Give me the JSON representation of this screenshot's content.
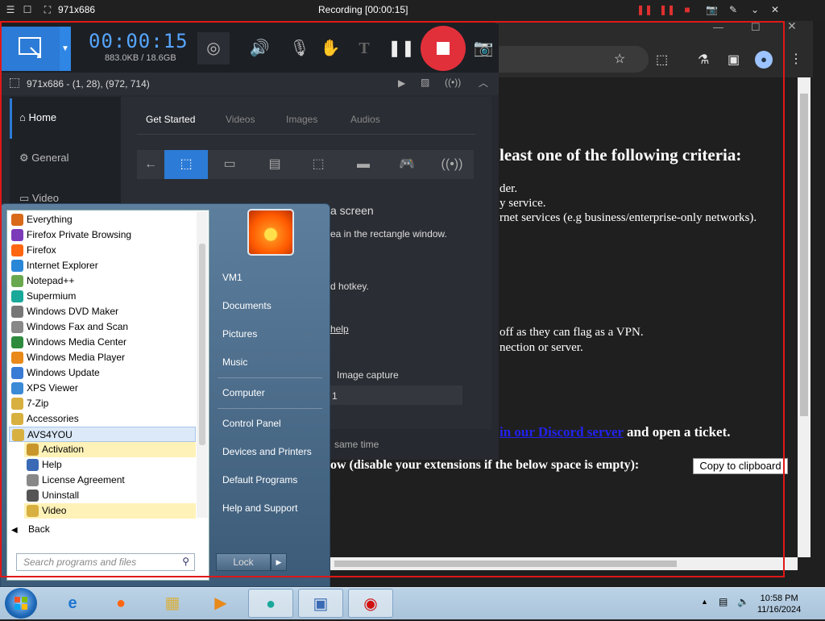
{
  "recorder_bar": {
    "resolution": "971x686",
    "title": "Recording [00:00:15]"
  },
  "app": {
    "timer": "00:00:15",
    "size": "883.0KB / 18.6GB",
    "info": "971x686 - (1, 28), (972, 714)",
    "sidebar": [
      "Home",
      "General",
      "Video"
    ],
    "tabs": [
      "Get Started",
      "Videos",
      "Images",
      "Audios"
    ],
    "content_fragments": {
      "heading": "a screen",
      "line1": "ea in the rectangle window.",
      "line2": "d hotkey.",
      "help": "help",
      "image_capture": "Image capture",
      "value": "1",
      "same_time": "same time"
    }
  },
  "browser": {
    "lines": [
      "least one of the following criteria:",
      "der.",
      "y service.",
      "rnet services (e.g business/enterprise-only networks).",
      "off as they can flag as a VPN.",
      "nection or server."
    ],
    "link_text": "in our Discord server",
    "after_link": " and open a ticket.",
    "bold_fragment": "ow (disable your extensions if the below space is empty):",
    "copy_button": "Copy to clipboard"
  },
  "start_menu": {
    "programs": [
      {
        "label": "Everything",
        "color": "#d86a1a"
      },
      {
        "label": "Firefox Private Browsing",
        "color": "#7c3bb8"
      },
      {
        "label": "Firefox",
        "color": "#ff6611"
      },
      {
        "label": "Internet Explorer",
        "color": "#2a87d8"
      },
      {
        "label": "Notepad++",
        "color": "#6aa84f"
      },
      {
        "label": "Supermium",
        "color": "#1aa89a"
      },
      {
        "label": "Windows DVD Maker",
        "color": "#777777"
      },
      {
        "label": "Windows Fax and Scan",
        "color": "#888888"
      },
      {
        "label": "Windows Media Center",
        "color": "#2e8b3e"
      },
      {
        "label": "Windows Media Player",
        "color": "#e8891a"
      },
      {
        "label": "Windows Update",
        "color": "#3a7bd5"
      },
      {
        "label": "XPS Viewer",
        "color": "#3a8ad5"
      },
      {
        "label": "7-Zip",
        "color": "#d8b040"
      },
      {
        "label": "Accessories",
        "color": "#d8b040"
      },
      {
        "label": "AVS4YOU",
        "color": "#d8b040"
      }
    ],
    "sub_programs": [
      {
        "label": "Activation",
        "color": "#c8962a"
      },
      {
        "label": "Help",
        "color": "#3a6ab5"
      },
      {
        "label": "License Agreement",
        "color": "#888888"
      },
      {
        "label": "Uninstall",
        "color": "#555555"
      },
      {
        "label": "Video",
        "color": "#d8b040"
      }
    ],
    "back": "Back",
    "search_placeholder": "Search programs and files",
    "right_items": [
      "VM1",
      "Documents",
      "Pictures",
      "Music",
      "Computer",
      "Control Panel",
      "Devices and Printers",
      "Default Programs",
      "Help and Support"
    ],
    "lock": "Lock"
  },
  "taskbar": {
    "time": "10:58 PM",
    "date": "11/16/2024"
  }
}
